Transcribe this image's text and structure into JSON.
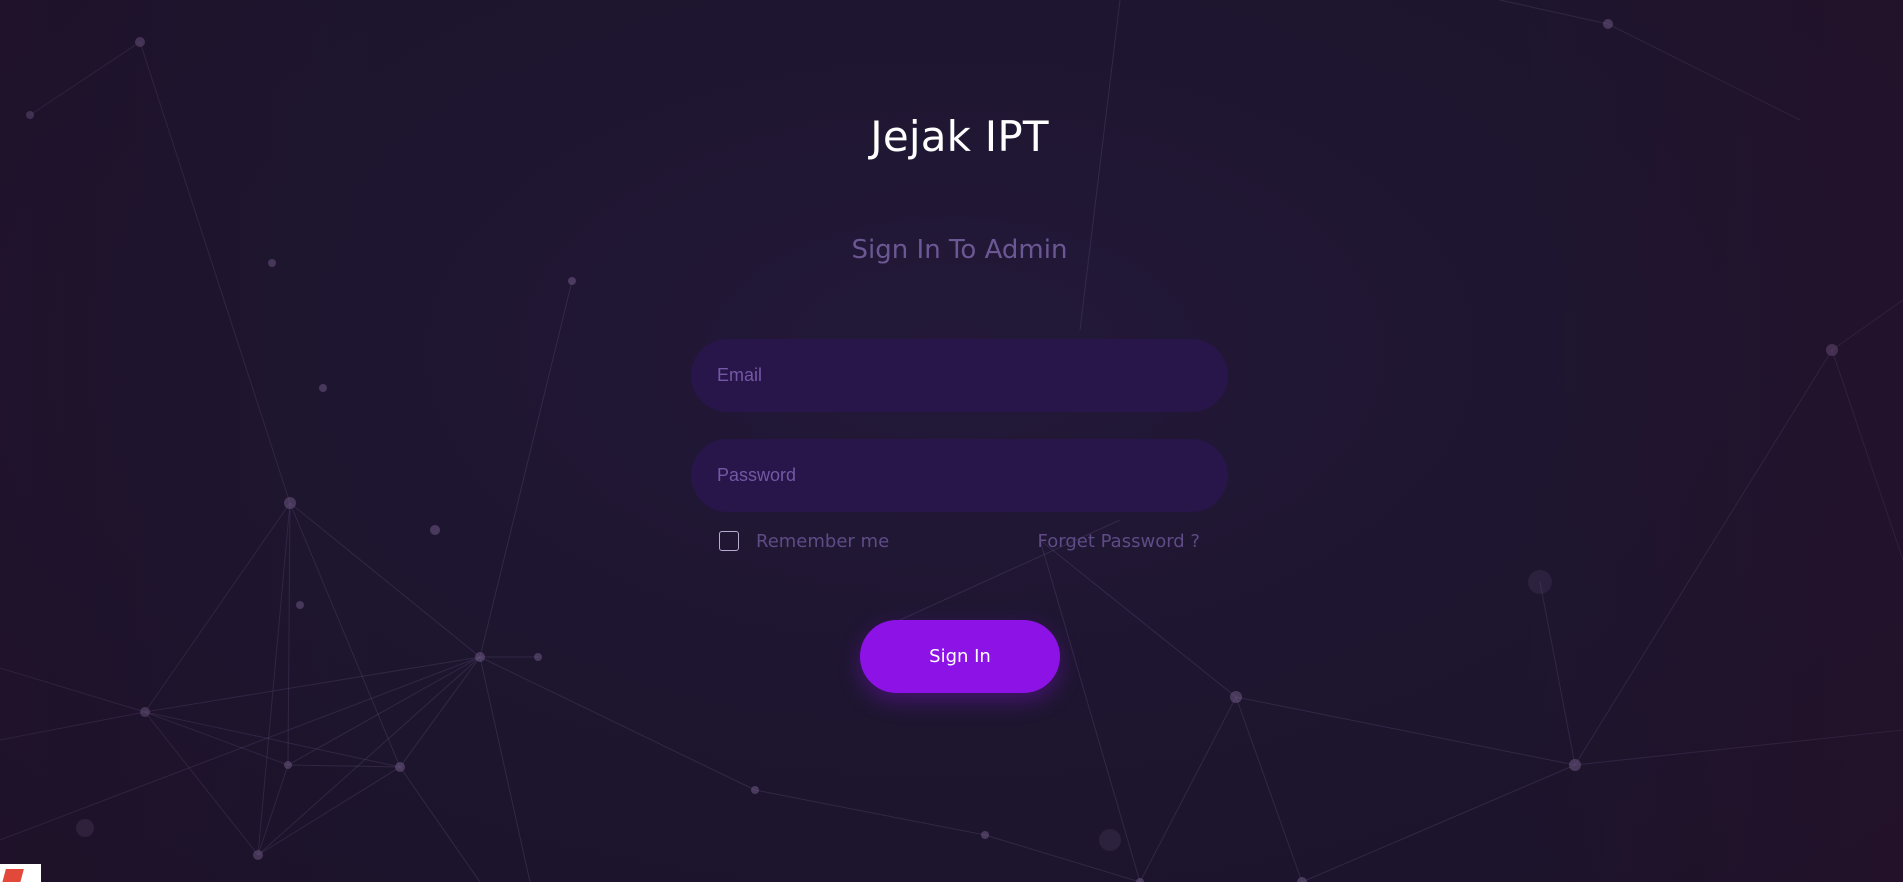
{
  "app": {
    "title": "Jejak IPT",
    "subtitle": "Sign In To Admin"
  },
  "form": {
    "email_placeholder": "Email",
    "password_placeholder": "Password",
    "remember_label": "Remember me",
    "forgot_label": "Forget Password ?",
    "signin_label": "Sign In"
  },
  "colors": {
    "background": "#1e1630",
    "field_background": "#28154a",
    "accent": "#8d12e6",
    "muted_text": "#6a5793"
  },
  "icons": {
    "corner_badge": "app-logo-icon",
    "checkbox": "checkbox-icon"
  }
}
